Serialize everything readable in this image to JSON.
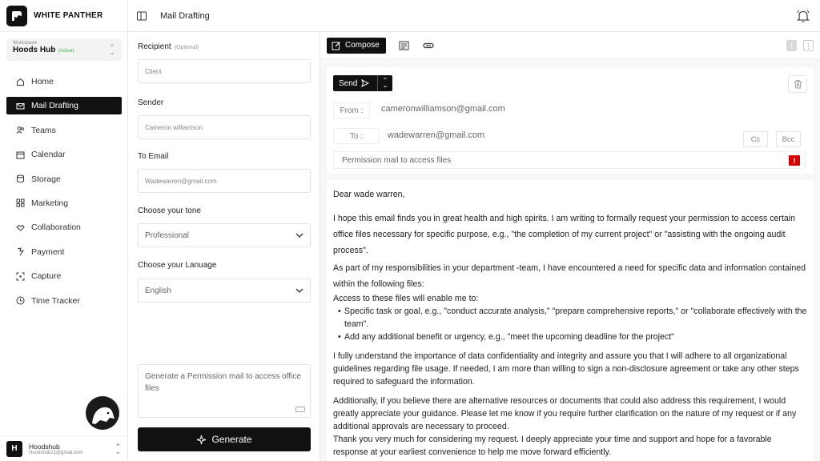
{
  "brand": {
    "name": "WHITE PANTHER"
  },
  "workspace": {
    "label": "Workspace",
    "name": "Hoods Hub",
    "badge": "(Active)"
  },
  "nav": [
    {
      "label": "Home",
      "icon": "home-icon"
    },
    {
      "label": "Mail Drafting",
      "icon": "mail-icon",
      "active": true
    },
    {
      "label": "Teams",
      "icon": "users-icon"
    },
    {
      "label": "Calendar",
      "icon": "calendar-icon"
    },
    {
      "label": "Storage",
      "icon": "storage-icon"
    },
    {
      "label": "Marketing",
      "icon": "grid-icon"
    },
    {
      "label": "Collaboration",
      "icon": "handshake-icon"
    },
    {
      "label": "Payment",
      "icon": "payment-icon"
    },
    {
      "label": "Capture",
      "icon": "capture-icon"
    },
    {
      "label": "Time Tracker",
      "icon": "clock-icon"
    }
  ],
  "user": {
    "initial": "H",
    "name": "Hoodshub",
    "email": "Hoodshub21@gmail.com"
  },
  "header": {
    "title": "Mail Drafting"
  },
  "form": {
    "recipient_label": "Recipient",
    "recipient_optional": "(Optional)",
    "recipient_value": "Client",
    "sender_label": "Sender",
    "sender_value": "Cameron williamson",
    "to_label": "To Email",
    "to_value": "Wadewarren@gmail.com",
    "tone_label": "Choose your tone",
    "tone_value": "Professional",
    "language_label": "Choose your Lanuage",
    "language_value": "English",
    "prompt": "Generate a Permission mail to access office files",
    "generate_label": "Generate"
  },
  "toolbar": {
    "compose_label": "Compose"
  },
  "email": {
    "send_label": "Send",
    "from_label": "From :",
    "from_value": "cameronwilliamson@gmail.com",
    "to_label": "To :",
    "to_value": "wadewarren@gmail.com",
    "cc_label": "Cc",
    "bcc_label": "Bcc",
    "subject": "Permission mail to access files",
    "alert_mark": "!",
    "greeting": "Dear wade warren,",
    "p1": "I hope this email finds you in great health and high spirits. I am writing to formally request your permission to access certain office files necessary for specific purpose, e.g., \"the completion of my current project\" or \"assisting with the ongoing audit process\".",
    "p2": "As part of my responsibilities in your department -team, I have encountered a need for specific data and information contained within the following files:",
    "p3": "Access to these files will enable me to:",
    "bullet1": "Specific task or goal, e.g., \"conduct accurate analysis,\" \"prepare comprehensive reports,\" or \"collaborate effectively with the team\".",
    "bullet2": "Add any additional benefit or urgency, e.g., \"meet the upcoming deadline for the project\"",
    "p4": "I fully understand the importance of data confidentiality and integrity and assure you that I will adhere to all organizational guidelines regarding file usage. If needed, I am more than willing to sign a non-disclosure agreement or take any other steps required to safeguard the information.",
    "p5": "Additionally, if you believe there are alternative resources or documents that could also address this requirement, I would greatly appreciate your guidance. Please let me know if you require further clarification on the nature of my request or if any additional approvals are necessary to proceed.",
    "p6": "Thank you very much for considering my request. I deeply appreciate your time and support and hope for a favorable response at your earliest convenience to help me move forward efficiently."
  }
}
